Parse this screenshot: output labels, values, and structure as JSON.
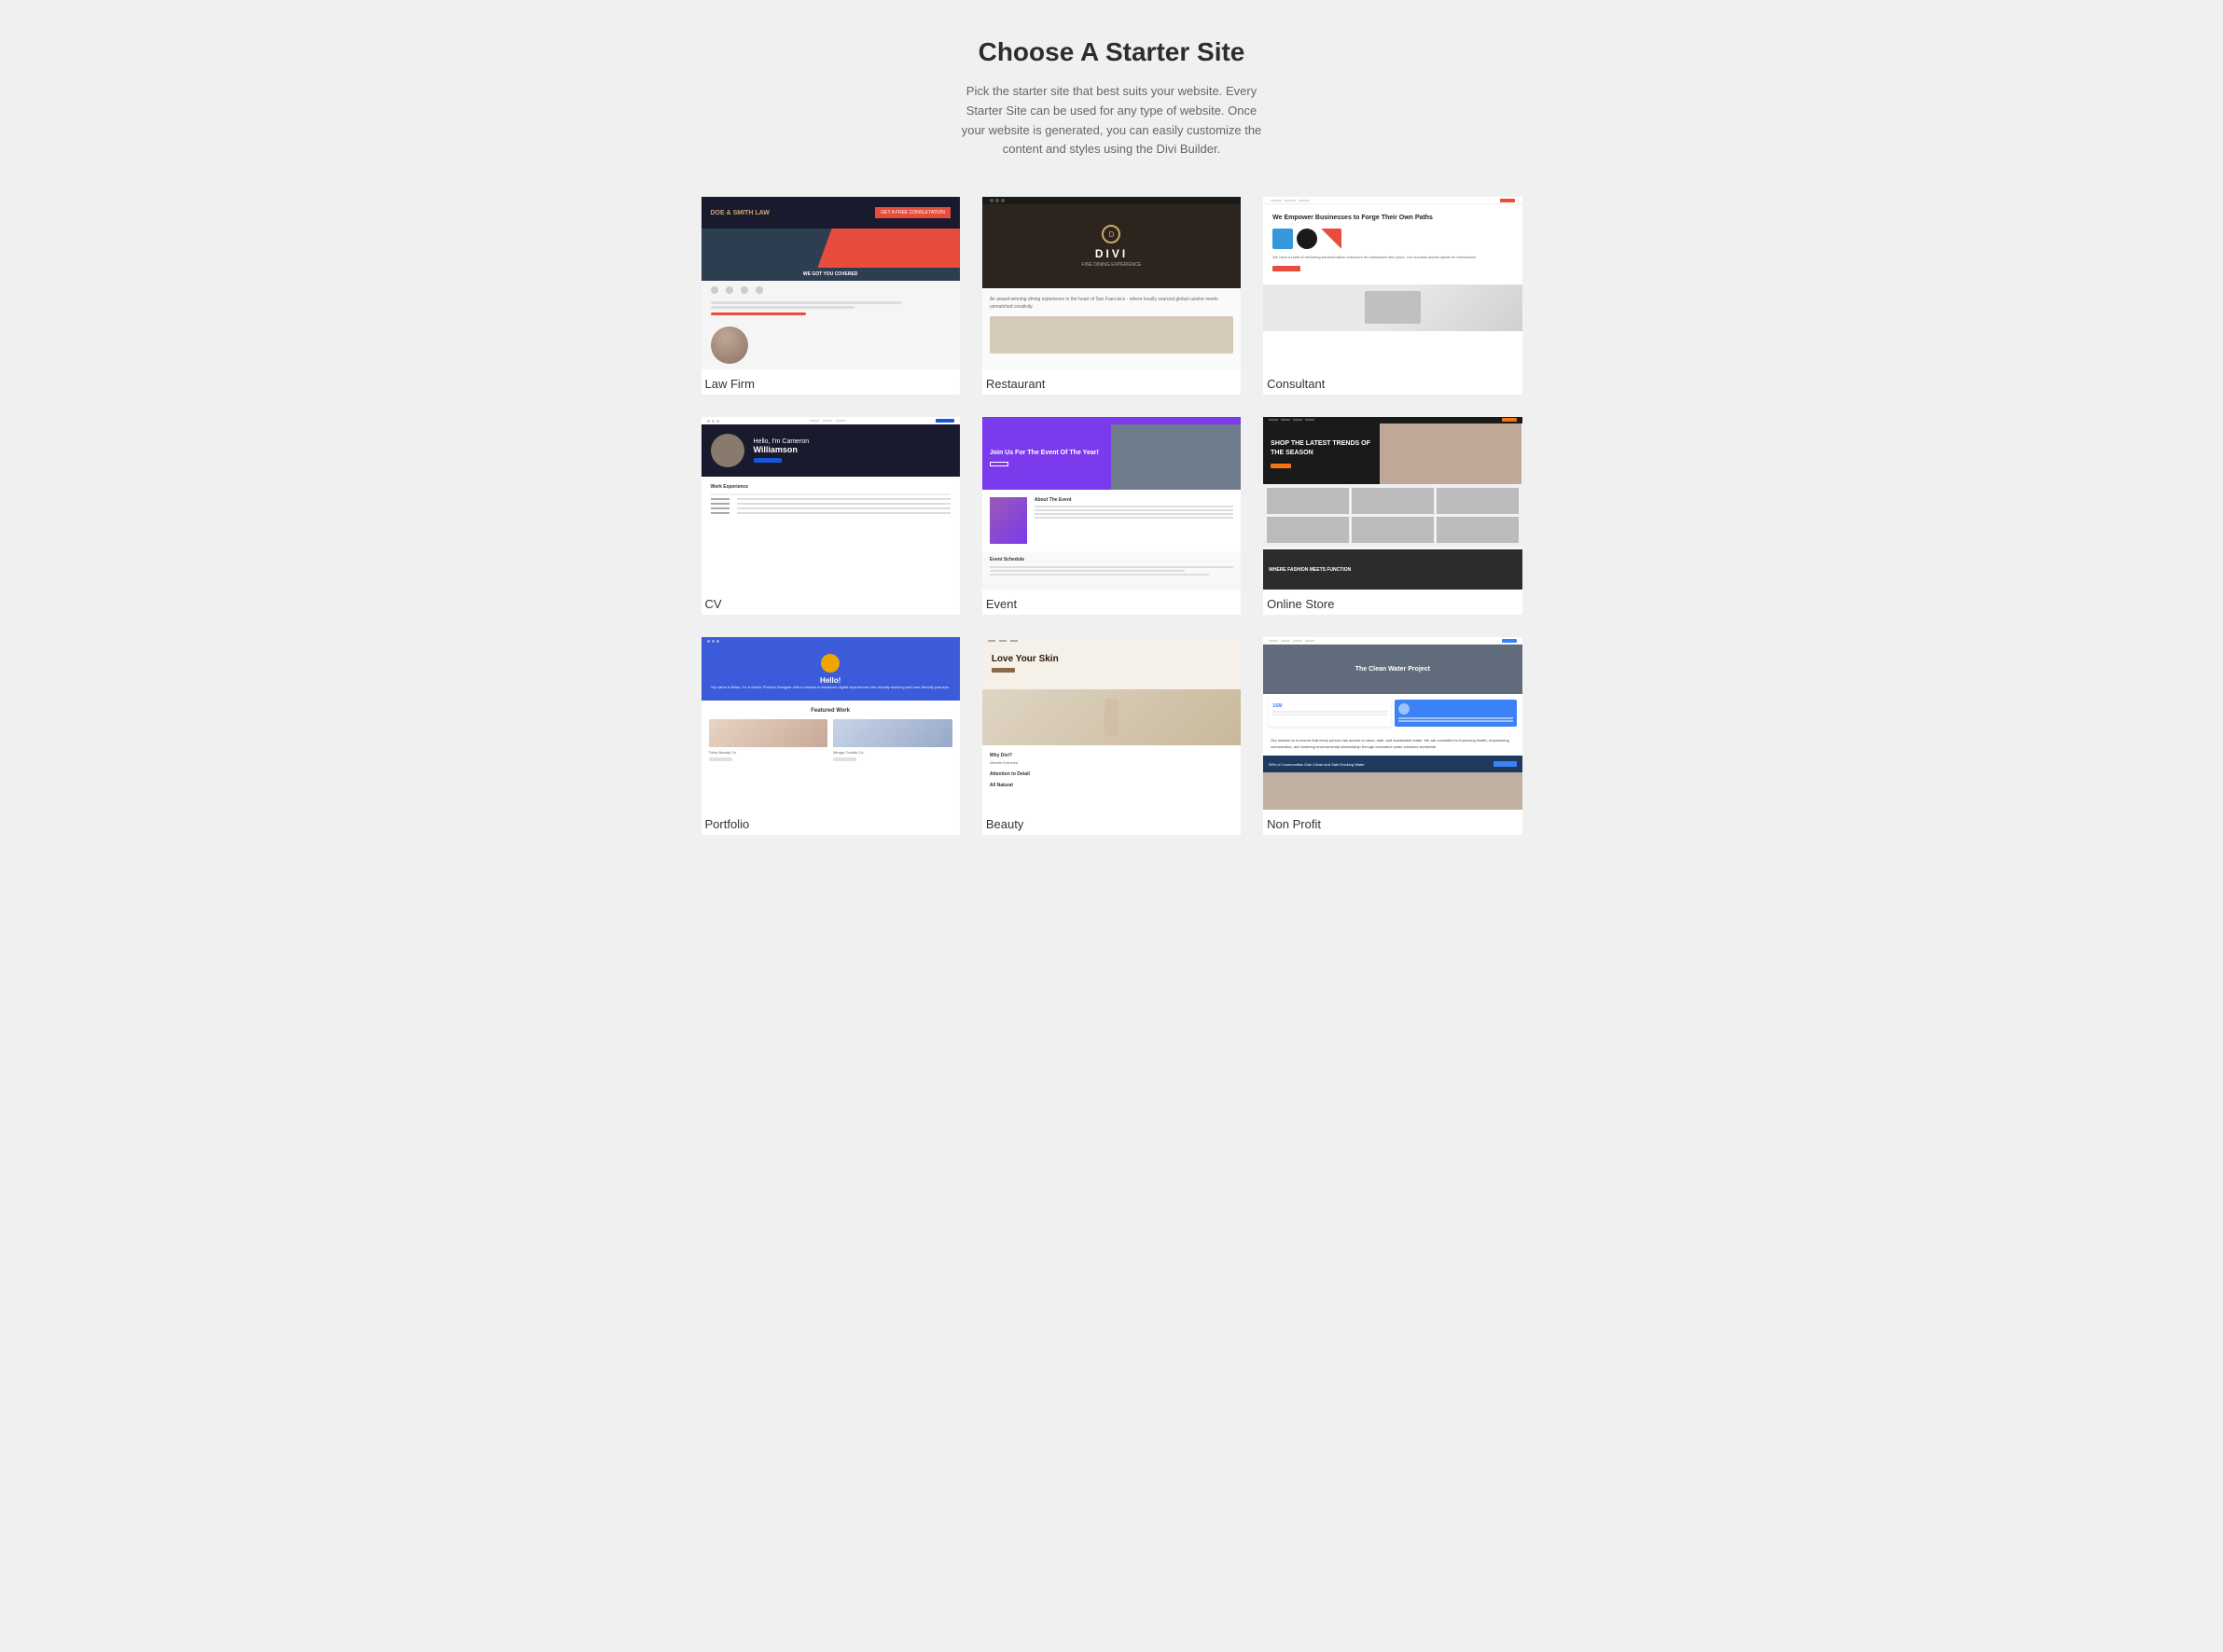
{
  "header": {
    "title": "Choose A Starter Site",
    "subtitle": "Pick the starter site that best suits your website. Every Starter Site can be used for any type of website. Once your website is generated, you can easily customize the content and styles using the Divi Builder."
  },
  "cards": [
    {
      "id": "law-firm",
      "label": "Law Firm",
      "preview_type": "law"
    },
    {
      "id": "restaurant",
      "label": "Restaurant",
      "preview_type": "restaurant"
    },
    {
      "id": "consultant",
      "label": "Consultant",
      "preview_type": "consultant"
    },
    {
      "id": "cv",
      "label": "CV",
      "preview_type": "cv"
    },
    {
      "id": "event",
      "label": "Event",
      "preview_type": "event"
    },
    {
      "id": "online-store",
      "label": "Online Store",
      "preview_type": "store"
    },
    {
      "id": "portfolio",
      "label": "Portfolio",
      "preview_type": "portfolio"
    },
    {
      "id": "beauty",
      "label": "Beauty",
      "preview_type": "beauty"
    },
    {
      "id": "non-profit",
      "label": "Non Profit",
      "preview_type": "nonprofit"
    }
  ]
}
